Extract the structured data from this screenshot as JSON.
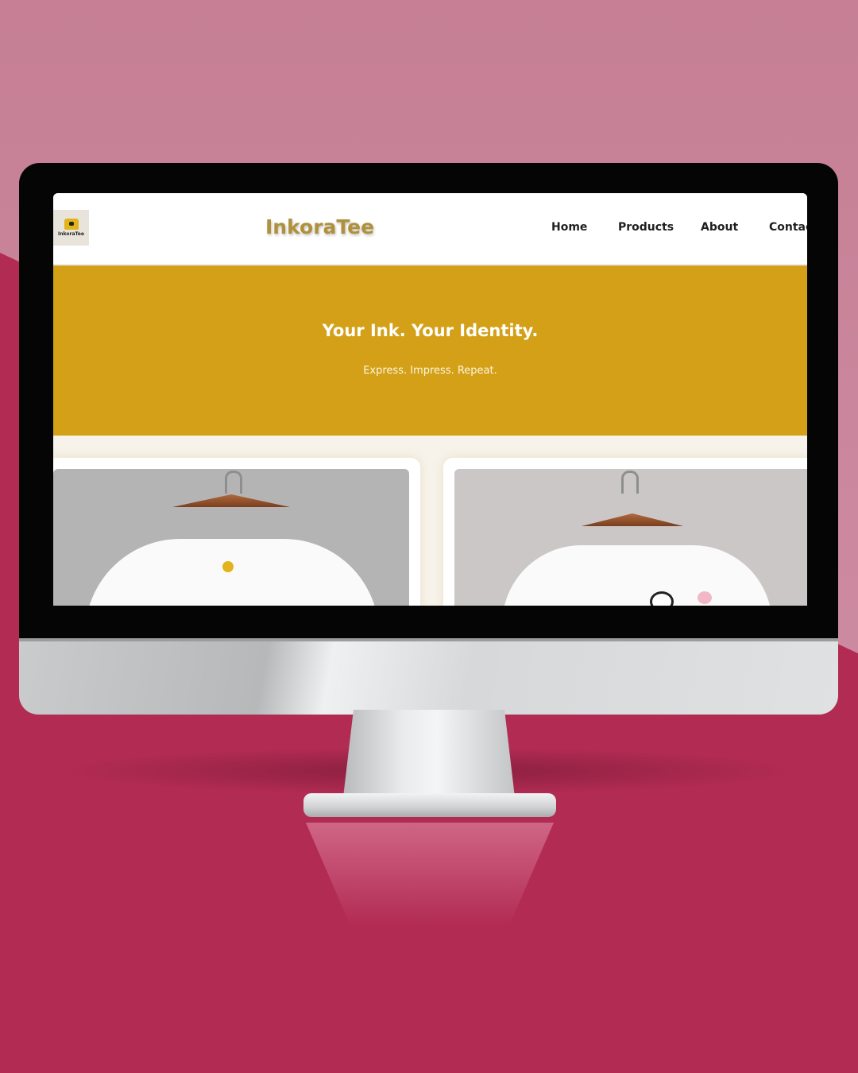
{
  "site": {
    "brand": "InkoraTee",
    "logo_text": "InkoraTee"
  },
  "nav": {
    "items": [
      {
        "label": "Home"
      },
      {
        "label": "Products"
      },
      {
        "label": "About"
      },
      {
        "label": "Contact"
      }
    ]
  },
  "hero": {
    "title": "Your Ink. Your Identity.",
    "subtitle": "Express. Impress. Repeat."
  },
  "colors": {
    "accent": "#d4a017",
    "brand_text": "#b0913b",
    "background": "#b22b53"
  }
}
